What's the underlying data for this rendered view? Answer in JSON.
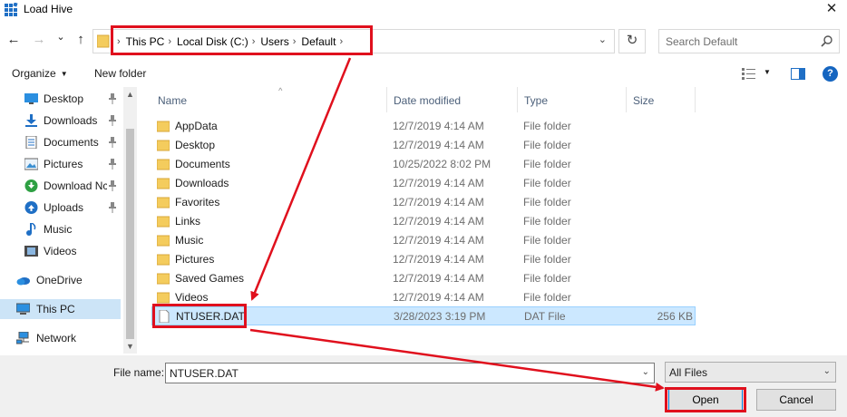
{
  "window": {
    "title": "Load Hive",
    "close_glyph": "✕"
  },
  "nav": {
    "back_glyph": "←",
    "forward_glyph": "→",
    "recent_glyph": "⌄",
    "up_glyph": "↑",
    "breadcrumbs": [
      "This PC",
      "Local Disk (C:)",
      "Users",
      "Default"
    ],
    "crumb_sep": "›",
    "dropdown_glyph": "⌄",
    "refresh_glyph": "↻",
    "search_placeholder": "Search Default"
  },
  "toolbar": {
    "organize_label": "Organize",
    "new_folder_label": "New folder",
    "caret_glyph": "▼",
    "help_glyph": "?"
  },
  "sidebar": {
    "items": [
      {
        "label": "Desktop",
        "icon": "desktop-icon",
        "pinned": true
      },
      {
        "label": "Downloads",
        "icon": "download-icon",
        "pinned": true
      },
      {
        "label": "Documents",
        "icon": "documents-icon",
        "pinned": true
      },
      {
        "label": "Pictures",
        "icon": "pictures-icon",
        "pinned": true
      },
      {
        "label": "Download Nc",
        "icon": "green-download-icon",
        "pinned": true
      },
      {
        "label": "Uploads",
        "icon": "upload-icon",
        "pinned": true
      },
      {
        "label": "Music",
        "icon": "music-icon",
        "pinned": false
      },
      {
        "label": "Videos",
        "icon": "video-icon",
        "pinned": false
      },
      {
        "label": "OneDrive",
        "icon": "onedrive-icon",
        "pinned": false
      },
      {
        "label": "This PC",
        "icon": "computer-icon",
        "pinned": false
      },
      {
        "label": "Network",
        "icon": "network-icon",
        "pinned": false
      }
    ],
    "scroll_up_glyph": "▲",
    "scroll_down_glyph": "▼"
  },
  "filelist": {
    "columns": [
      "Name",
      "Date modified",
      "Type",
      "Size"
    ],
    "sort_glyph": "^",
    "rows": [
      {
        "name": "AppData",
        "date": "12/7/2019 4:14 AM",
        "type": "File folder",
        "size": "",
        "kind": "folder"
      },
      {
        "name": "Desktop",
        "date": "12/7/2019 4:14 AM",
        "type": "File folder",
        "size": "",
        "kind": "folder"
      },
      {
        "name": "Documents",
        "date": "10/25/2022 8:02 PM",
        "type": "File folder",
        "size": "",
        "kind": "folder"
      },
      {
        "name": "Downloads",
        "date": "12/7/2019 4:14 AM",
        "type": "File folder",
        "size": "",
        "kind": "folder"
      },
      {
        "name": "Favorites",
        "date": "12/7/2019 4:14 AM",
        "type": "File folder",
        "size": "",
        "kind": "folder"
      },
      {
        "name": "Links",
        "date": "12/7/2019 4:14 AM",
        "type": "File folder",
        "size": "",
        "kind": "folder"
      },
      {
        "name": "Music",
        "date": "12/7/2019 4:14 AM",
        "type": "File folder",
        "size": "",
        "kind": "folder"
      },
      {
        "name": "Pictures",
        "date": "12/7/2019 4:14 AM",
        "type": "File folder",
        "size": "",
        "kind": "folder"
      },
      {
        "name": "Saved Games",
        "date": "12/7/2019 4:14 AM",
        "type": "File folder",
        "size": "",
        "kind": "folder"
      },
      {
        "name": "Videos",
        "date": "12/7/2019 4:14 AM",
        "type": "File folder",
        "size": "",
        "kind": "folder"
      },
      {
        "name": "NTUSER.DAT",
        "date": "3/28/2023 3:19 PM",
        "type": "DAT File",
        "size": "256 KB",
        "kind": "file"
      }
    ]
  },
  "bottom": {
    "filename_label": "File name:",
    "filename_value": "NTUSER.DAT",
    "filter_value": "All Files",
    "dropdown_glyph": "⌄",
    "open_label": "Open",
    "cancel_label": "Cancel"
  },
  "colors": {
    "annotation_red": "#e0101d",
    "selection_blue": "#cce8ff",
    "folder_yellow": "#f4cc5d"
  }
}
